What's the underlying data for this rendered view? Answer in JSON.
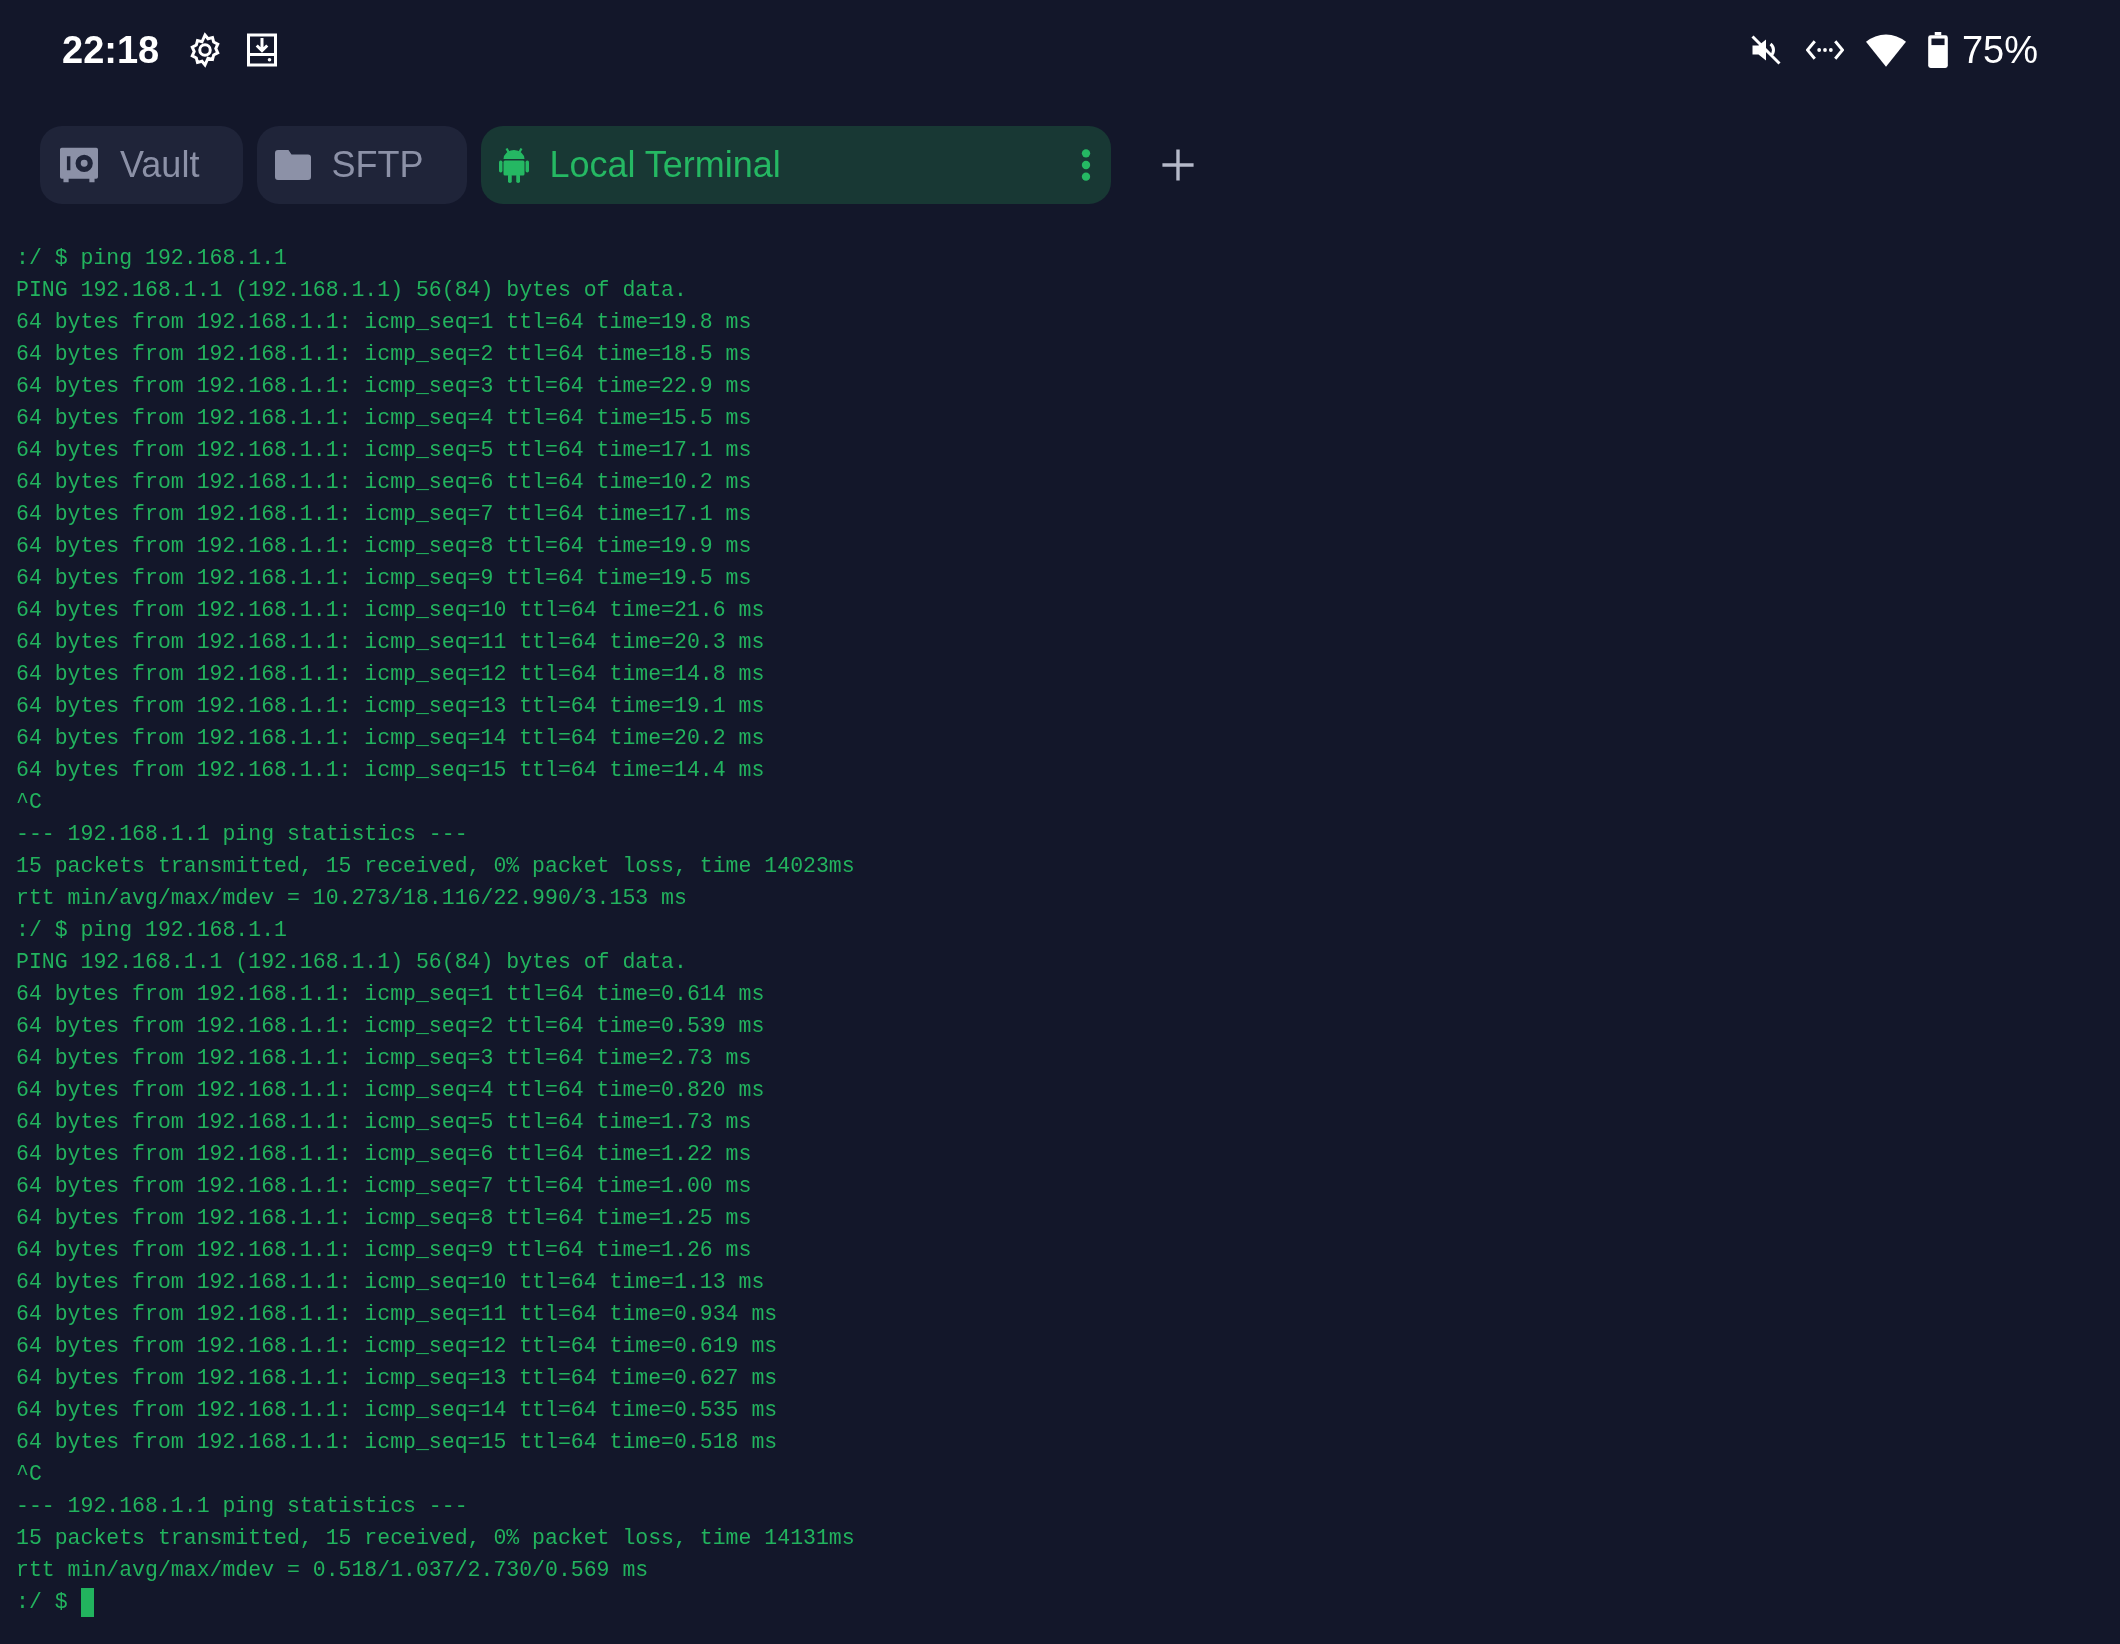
{
  "status_bar": {
    "time": "22:18",
    "battery_percent": "75%"
  },
  "tabs": [
    {
      "label": "Vault",
      "kind": "vault",
      "selected": false
    },
    {
      "label": "SFTP",
      "kind": "files",
      "selected": false
    },
    {
      "label": "Local Terminal",
      "kind": "local",
      "selected": true
    }
  ],
  "terminal": {
    "lines": [
      ":/ $ ping 192.168.1.1",
      "PING 192.168.1.1 (192.168.1.1) 56(84) bytes of data.",
      "64 bytes from 192.168.1.1: icmp_seq=1 ttl=64 time=19.8 ms",
      "64 bytes from 192.168.1.1: icmp_seq=2 ttl=64 time=18.5 ms",
      "64 bytes from 192.168.1.1: icmp_seq=3 ttl=64 time=22.9 ms",
      "64 bytes from 192.168.1.1: icmp_seq=4 ttl=64 time=15.5 ms",
      "64 bytes from 192.168.1.1: icmp_seq=5 ttl=64 time=17.1 ms",
      "64 bytes from 192.168.1.1: icmp_seq=6 ttl=64 time=10.2 ms",
      "64 bytes from 192.168.1.1: icmp_seq=7 ttl=64 time=17.1 ms",
      "64 bytes from 192.168.1.1: icmp_seq=8 ttl=64 time=19.9 ms",
      "64 bytes from 192.168.1.1: icmp_seq=9 ttl=64 time=19.5 ms",
      "64 bytes from 192.168.1.1: icmp_seq=10 ttl=64 time=21.6 ms",
      "64 bytes from 192.168.1.1: icmp_seq=11 ttl=64 time=20.3 ms",
      "64 bytes from 192.168.1.1: icmp_seq=12 ttl=64 time=14.8 ms",
      "64 bytes from 192.168.1.1: icmp_seq=13 ttl=64 time=19.1 ms",
      "64 bytes from 192.168.1.1: icmp_seq=14 ttl=64 time=20.2 ms",
      "64 bytes from 192.168.1.1: icmp_seq=15 ttl=64 time=14.4 ms",
      "^C",
      "--- 192.168.1.1 ping statistics ---",
      "15 packets transmitted, 15 received, 0% packet loss, time 14023ms",
      "rtt min/avg/max/mdev = 10.273/18.116/22.990/3.153 ms",
      ":/ $ ping 192.168.1.1",
      "PING 192.168.1.1 (192.168.1.1) 56(84) bytes of data.",
      "64 bytes from 192.168.1.1: icmp_seq=1 ttl=64 time=0.614 ms",
      "64 bytes from 192.168.1.1: icmp_seq=2 ttl=64 time=0.539 ms",
      "64 bytes from 192.168.1.1: icmp_seq=3 ttl=64 time=2.73 ms",
      "64 bytes from 192.168.1.1: icmp_seq=4 ttl=64 time=0.820 ms",
      "64 bytes from 192.168.1.1: icmp_seq=5 ttl=64 time=1.73 ms",
      "64 bytes from 192.168.1.1: icmp_seq=6 ttl=64 time=1.22 ms",
      "64 bytes from 192.168.1.1: icmp_seq=7 ttl=64 time=1.00 ms",
      "64 bytes from 192.168.1.1: icmp_seq=8 ttl=64 time=1.25 ms",
      "64 bytes from 192.168.1.1: icmp_seq=9 ttl=64 time=1.26 ms",
      "64 bytes from 192.168.1.1: icmp_seq=10 ttl=64 time=1.13 ms",
      "64 bytes from 192.168.1.1: icmp_seq=11 ttl=64 time=0.934 ms",
      "64 bytes from 192.168.1.1: icmp_seq=12 ttl=64 time=0.619 ms",
      "64 bytes from 192.168.1.1: icmp_seq=13 ttl=64 time=0.627 ms",
      "64 bytes from 192.168.1.1: icmp_seq=14 ttl=64 time=0.535 ms",
      "64 bytes from 192.168.1.1: icmp_seq=15 ttl=64 time=0.518 ms",
      "^C",
      "--- 192.168.1.1 ping statistics ---",
      "15 packets transmitted, 15 received, 0% packet loss, time 14131ms",
      "rtt min/avg/max/mdev = 0.518/1.037/2.730/0.569 ms"
    ],
    "prompt": ":/ $"
  }
}
